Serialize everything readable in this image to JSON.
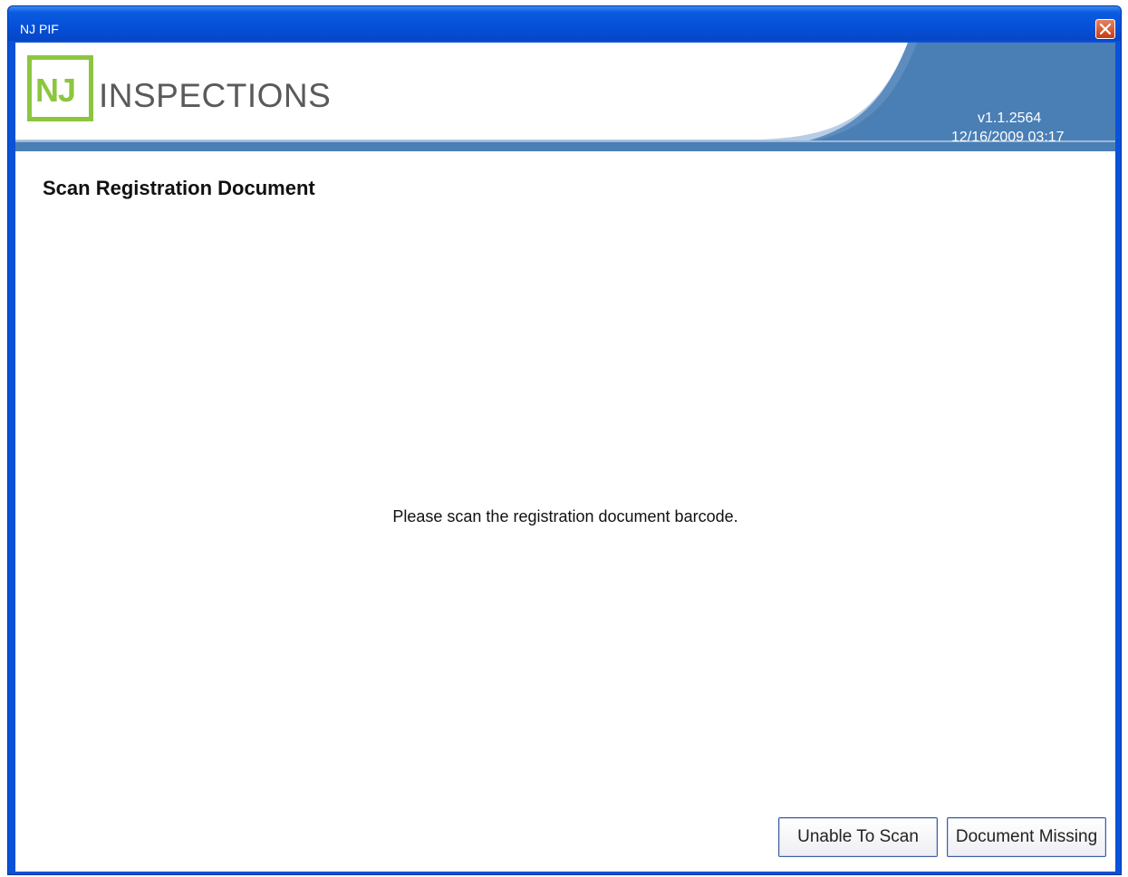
{
  "window": {
    "title": "NJ PIF"
  },
  "header": {
    "logo_mark": "NJ",
    "logo_word": "INSPECTIONS",
    "version": "v1.1.2564",
    "datetime": "12/16/2009 03:17"
  },
  "main": {
    "page_title": "Scan Registration Document",
    "instruction": "Please scan the registration document barcode."
  },
  "buttons": {
    "unable_to_scan": "Unable To Scan",
    "document_missing": "Document Missing"
  },
  "colors": {
    "brand_green": "#8cc63f",
    "banner_blue": "#4a7fb5",
    "titlebar_blue": "#0a52d8",
    "close_red": "#c73b16"
  },
  "icons": {
    "close": "close-icon"
  }
}
